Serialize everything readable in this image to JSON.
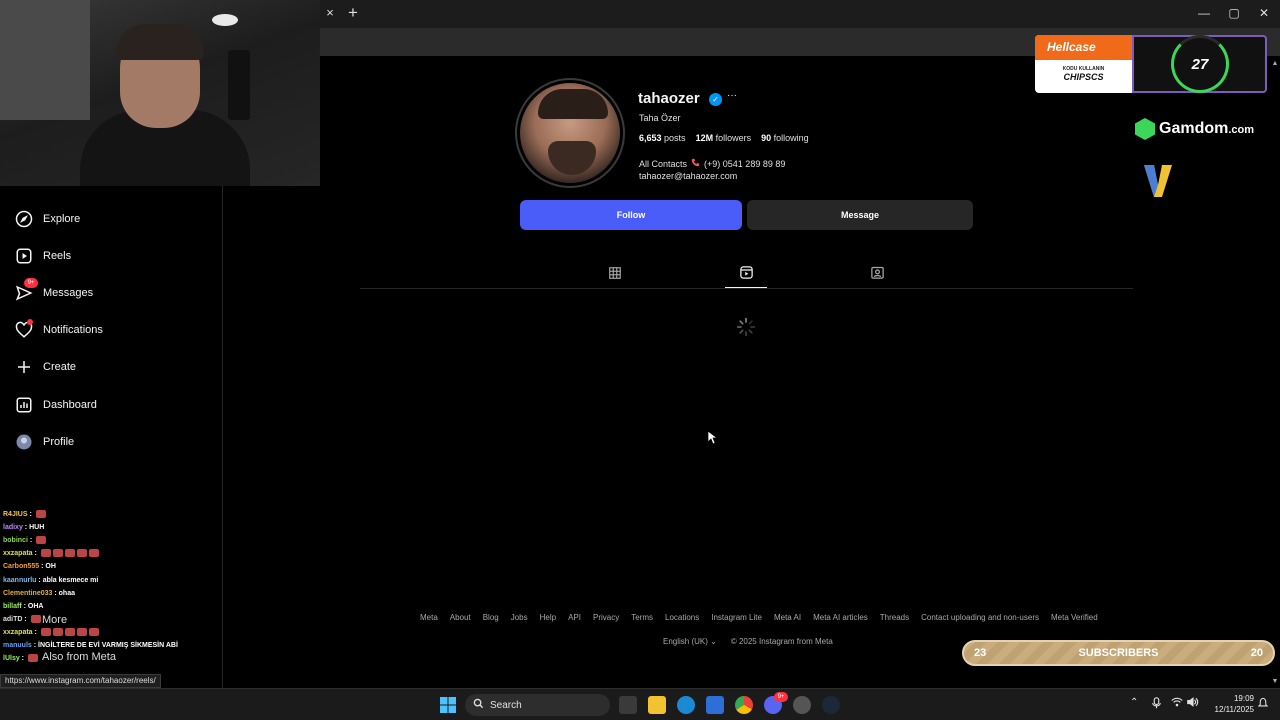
{
  "browser": {
    "tab_close": "×",
    "tab_new": "+",
    "minimize": "—",
    "restore": "▢",
    "close": "✕",
    "status_url": "https://www.instagram.com/tahaozer/reels/"
  },
  "sidebar": {
    "items": [
      {
        "label": "Explore",
        "icon": "compass-icon"
      },
      {
        "label": "Reels",
        "icon": "reels-icon"
      },
      {
        "label": "Messages",
        "icon": "messenger-icon",
        "badge": "9+"
      },
      {
        "label": "Notifications",
        "icon": "heart-icon"
      },
      {
        "label": "Create",
        "icon": "plus-icon"
      },
      {
        "label": "Dashboard",
        "icon": "dashboard-icon"
      },
      {
        "label": "Profile",
        "icon": "avatar-icon"
      }
    ],
    "more_label": "More",
    "also_from_meta": "Also from Meta"
  },
  "chat": [
    {
      "user": "R4JIUS",
      "sep": " : ",
      "msg": "",
      "color": "#f5c542",
      "emotes": 1
    },
    {
      "user": "ladixy",
      "sep": " : ",
      "msg": "HUH",
      "color": "#b98cf5",
      "emotes": 0
    },
    {
      "user": "bobinci",
      "sep": " : ",
      "msg": "",
      "color": "#8bd35a",
      "emotes": 1
    },
    {
      "user": "xxzapata",
      "sep": " : ",
      "msg": "",
      "color": "#e0e048",
      "emotes": 5
    },
    {
      "user": "Carbon555",
      "sep": " : ",
      "msg": "OH",
      "color": "#f0a040",
      "emotes": 0
    },
    {
      "user": "kaannurlu",
      "sep": " : ",
      "msg": "abla kesmece mi",
      "color": "#7fb7f0",
      "emotes": 0
    },
    {
      "user": "Clementine033",
      "sep": " : ",
      "msg": "ohaa",
      "color": "#e0b040",
      "emotes": 0
    },
    {
      "user": "billaff",
      "sep": " : ",
      "msg": "OHA",
      "color": "#9bf06a",
      "emotes": 0
    },
    {
      "user": "adiTD",
      "sep": " : ",
      "msg": "",
      "color": "#ddd",
      "emotes": 1
    },
    {
      "user": "xxzapata",
      "sep": " : ",
      "msg": "",
      "color": "#e0e048",
      "emotes": 5
    },
    {
      "user": "manuuls",
      "sep": " : ",
      "msg": "İNGİLTERE DE EVİ VARMIŞ SİKMESİN ABİ",
      "color": "#6aa0f0",
      "emotes": 0
    },
    {
      "user": "lUlsy",
      "sep": " : ",
      "msg": "",
      "color": "#9bf06a",
      "emotes": 1
    }
  ],
  "profile": {
    "username": "tahaozer",
    "verified_glyph": "✓",
    "more_glyph": "···",
    "full_name": "Taha Özer",
    "posts_count": "6,653",
    "posts_label": "posts",
    "followers_count": "12M",
    "followers_label": "followers",
    "following_count": "90",
    "following_label": "following",
    "contact_label": "All Contacts",
    "phone": "(+9) 0541 289 89 89",
    "email": "tahaozer@tahaozer.com",
    "follow_label": "Follow",
    "message_label": "Message",
    "tabs": [
      {
        "name": "posts-grid-icon"
      },
      {
        "name": "reels-icon",
        "active": true
      },
      {
        "name": "tagged-icon"
      }
    ]
  },
  "footer": {
    "links": [
      "Meta",
      "About",
      "Blog",
      "Jobs",
      "Help",
      "API",
      "Privacy",
      "Terms",
      "Locations",
      "Instagram Lite",
      "Meta AI",
      "Meta AI articles",
      "Threads",
      "Contact uploading and non-users",
      "Meta Verified"
    ],
    "language": "English (UK)",
    "copyright": "© 2025 Instagram from Meta"
  },
  "overlays": {
    "hellcase_brand": "Hellcase",
    "hellcase_small": "KODU KULLANIN",
    "hellcase_code": "CHIPSCS",
    "timer_value": "27",
    "gamdom_brand": "Gamdom",
    "gamdom_tld": ".com",
    "subs_left": "23",
    "subs_label": "SUBSCRIBERS",
    "subs_right": "20"
  },
  "taskbar": {
    "search_label": "Search",
    "time": "19:09",
    "date": "12/11/2025",
    "discord_badge": "9+"
  }
}
